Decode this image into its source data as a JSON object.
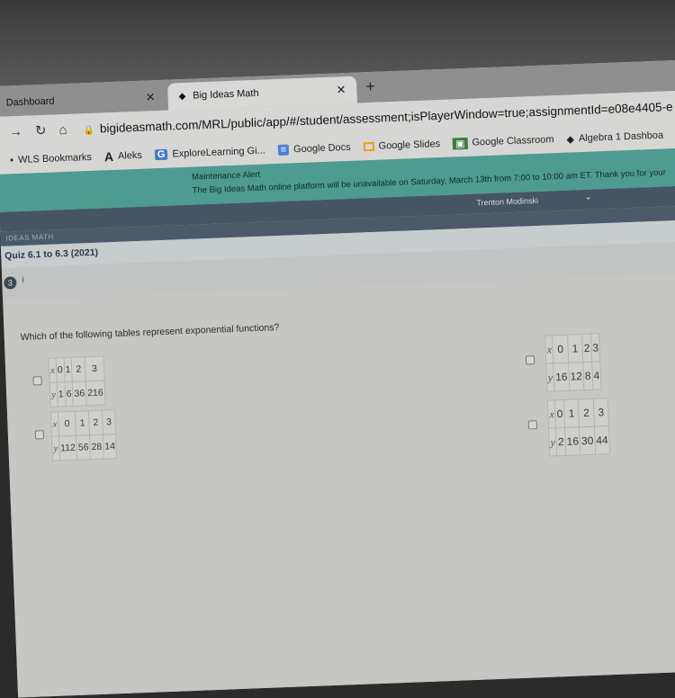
{
  "browser": {
    "tabs": [
      {
        "label": "Dashboard",
        "active": false
      },
      {
        "label": "Big Ideas Math",
        "active": true
      }
    ],
    "url": "bigideasmath.com/MRL/public/app/#/student/assessment;isPlayerWindow=true;assignmentId=e08e4405-e",
    "bookmarks": [
      {
        "icon": "bookmarks-folder-icon",
        "label": "WLS Bookmarks"
      },
      {
        "icon": "aleks-icon",
        "label": "Aleks"
      },
      {
        "icon": "explorelearning-icon",
        "label": "ExploreLearning Gi..."
      },
      {
        "icon": "google-docs-icon",
        "label": "Google Docs"
      },
      {
        "icon": "google-slides-icon",
        "label": "Google Slides"
      },
      {
        "icon": "google-classroom-icon",
        "label": "Google Classroom"
      },
      {
        "icon": "big-ideas-icon",
        "label": "Algebra 1 Dashboa"
      }
    ]
  },
  "alert": {
    "title": "Maintenance Alert",
    "message": "The Big Ideas Math online platform will be unavailable on Saturday, March 13th from 7:00 to 10:00 am ET. Thank you for your"
  },
  "user": {
    "name": "Trenton Modinski"
  },
  "brand": "IDEAS MATH",
  "quiz": {
    "title": "Quiz 6.1 to 6.3 (2021)",
    "question_number": "3",
    "info_label": "i"
  },
  "question": {
    "text": "Which of the following tables represent exponential functions?",
    "options": [
      {
        "x_label": "x",
        "y_label": "y",
        "x": [
          "0",
          "1",
          "2",
          "3"
        ],
        "y": [
          "1",
          "6",
          "36",
          "216"
        ]
      },
      {
        "x_label": "x",
        "y_label": "y",
        "x": [
          "0",
          "1",
          "2",
          "3"
        ],
        "y": [
          "112",
          "56",
          "28",
          "14"
        ]
      },
      {
        "x_label": "x",
        "y_label": "y",
        "x": [
          "0",
          "1",
          "2",
          "3"
        ],
        "y": [
          "16",
          "12",
          "8",
          "4"
        ]
      },
      {
        "x_label": "x",
        "y_label": "y",
        "x": [
          "0",
          "1",
          "2",
          "3"
        ],
        "y": [
          "2",
          "16",
          "30",
          "44"
        ]
      }
    ]
  }
}
